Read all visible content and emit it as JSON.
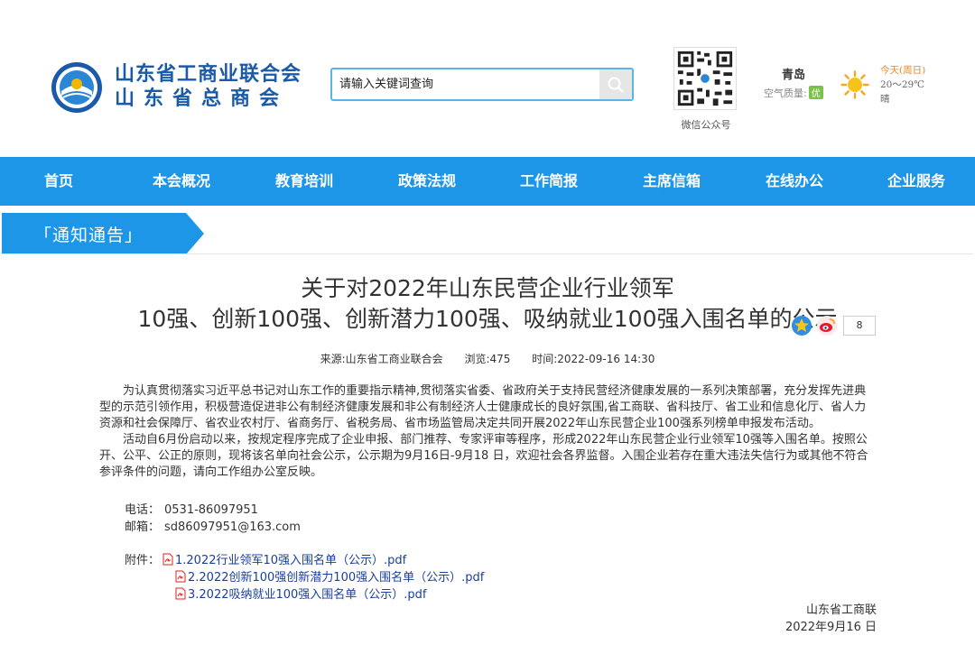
{
  "header": {
    "org_name_line1": "山东省工商业联合会",
    "org_name_line2": "山东省总商会",
    "search_placeholder": "请输入关键词查询",
    "qr_label": "微信公众号",
    "weather": {
      "city": "青岛",
      "aqi_label": "空气质量:",
      "aqi_value": "优",
      "day": "今天(周日)",
      "temp": "20～29℃",
      "condition": "晴"
    }
  },
  "nav": {
    "items": [
      "首页",
      "本会概况",
      "教育培训",
      "政策法规",
      "工作简报",
      "主席信箱",
      "在线办公",
      "企业服务"
    ]
  },
  "section": {
    "label": "「通知通告」"
  },
  "article": {
    "title_line1": "关于对2022年山东民营企业行业领军",
    "title_line2": "10强、创新100强、创新潜力100强、吸纳就业100强入围名单的公示",
    "share_count": "8",
    "meta": {
      "source": "来源:山东省工商业联合会",
      "views": "浏览:475",
      "time": "时间:2022-09-16 14:30"
    },
    "para1": "为认真贯彻落实习近平总书记对山东工作的重要指示精神,贯彻落实省委、省政府关于支持民营经济健康发展的一系列决策部署，充分发挥先进典型的示范引领作用，积极营造促进非公有制经济健康发展和非公有制经济人士健康成长的良好氛围,省工商联、省科技厅、省工业和信息化厅、省人力资源和社会保障厅、省农业农村厅、省商务厅、省税务局、省市场监管局决定共同开展2022年山东民营企业100强系列榜单申报发布活动。",
    "para2": "活动自6月份启动以来，按规定程序完成了企业申报、部门推荐、专家评审等程序，形成2022年山东民营企业行业领军10强等入围名单。按照公开、公平、公正的原则，现将该名单向社会公示，公示期为9月16日-9月18 日，欢迎社会各界监督。入围企业若存在重大违法失信行为或其他不符合参评条件的问题，请向工作组办公室反映。",
    "phone_label": "电话：",
    "phone": "0531-86097951",
    "email_label": "邮箱：",
    "email": "sd86097951@163.com",
    "attachments_label": "附件：",
    "attachments": [
      "1.2022行业领军10强入围名单（公示）.pdf",
      "2.2022创新100强创新潜力100强入围名单（公示）.pdf",
      "3.2022吸纳就业100强入围名单（公示）.pdf"
    ],
    "signer": "山东省工商联",
    "date": "2022年9月16 日"
  },
  "colors": {
    "nav_bg": "#1e96e8",
    "brand_text": "#1a5aa8",
    "link": "#1a3f9a"
  }
}
